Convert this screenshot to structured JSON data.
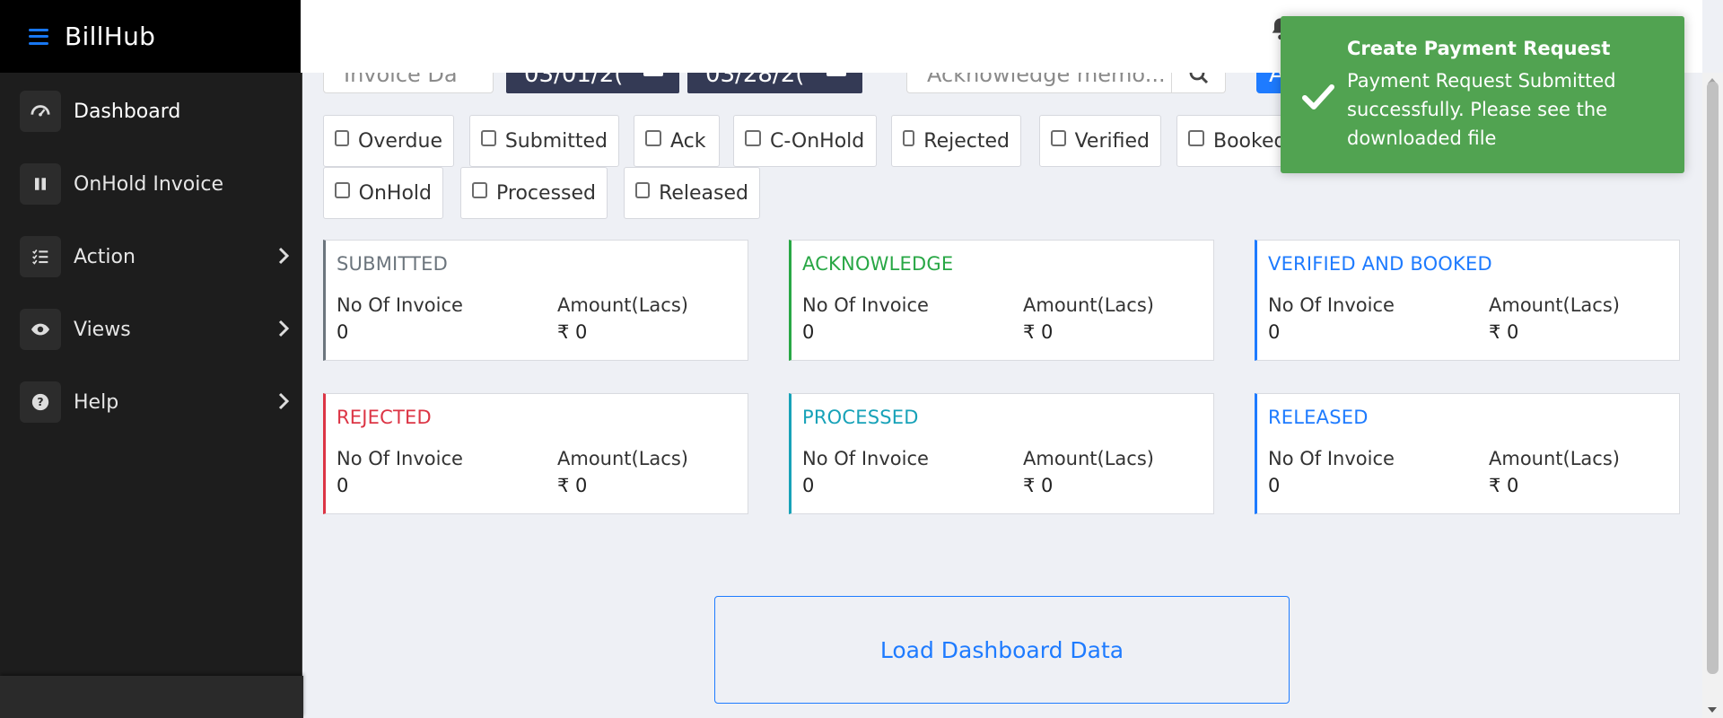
{
  "app": {
    "brand": "BillHub"
  },
  "sidebar": {
    "items": [
      {
        "label": "Dashboard",
        "icon": "gauge-icon"
      },
      {
        "label": "OnHold Invoice",
        "icon": "pause-icon"
      },
      {
        "label": "Action",
        "icon": "checklist-icon"
      },
      {
        "label": "Views",
        "icon": "eye-icon"
      },
      {
        "label": "Help",
        "icon": "question-icon"
      }
    ]
  },
  "filters": {
    "date_type_value": "Invoice Da",
    "date_from": "03/01/2(",
    "date_to": "03/28/2(",
    "search_placeholder": "Acknowledge memo...",
    "blue_button_label": "Ac"
  },
  "status_checkboxes": [
    "Overdue",
    "Submitted",
    "Ack",
    "C-OnHold",
    "Rejected",
    "Verified",
    "Booked",
    "OnHold",
    "Processed",
    "Released"
  ],
  "cards": [
    {
      "title": "SUBMITTED",
      "count_label": "No Of Invoice",
      "amount_label": "Amount(Lacs)",
      "count": "0",
      "amount": "₹ 0",
      "color": "#6c757d"
    },
    {
      "title": "ACKNOWLEDGE",
      "count_label": "No Of Invoice",
      "amount_label": "Amount(Lacs)",
      "count": "0",
      "amount": "₹ 0",
      "color": "#28a745"
    },
    {
      "title": "VERIFIED AND BOOKED",
      "count_label": "No Of Invoice",
      "amount_label": "Amount(Lacs)",
      "count": "0",
      "amount": "₹ 0",
      "color": "#1e7bff"
    },
    {
      "title": "REJECTED",
      "count_label": "No Of Invoice",
      "amount_label": "Amount(Lacs)",
      "count": "0",
      "amount": "₹ 0",
      "color": "#dc3545"
    },
    {
      "title": "PROCESSED",
      "count_label": "No Of Invoice",
      "amount_label": "Amount(Lacs)",
      "count": "0",
      "amount": "₹ 0",
      "color": "#17a2b8"
    },
    {
      "title": "RELEASED",
      "count_label": "No Of Invoice",
      "amount_label": "Amount(Lacs)",
      "count": "0",
      "amount": "₹ 0",
      "color": "#1e7bff"
    }
  ],
  "load_button": "Load Dashboard Data",
  "toast": {
    "title": "Create Payment Request",
    "message": "Payment Request Submitted successfully. Please see the downloaded file",
    "color": "#51a351"
  }
}
